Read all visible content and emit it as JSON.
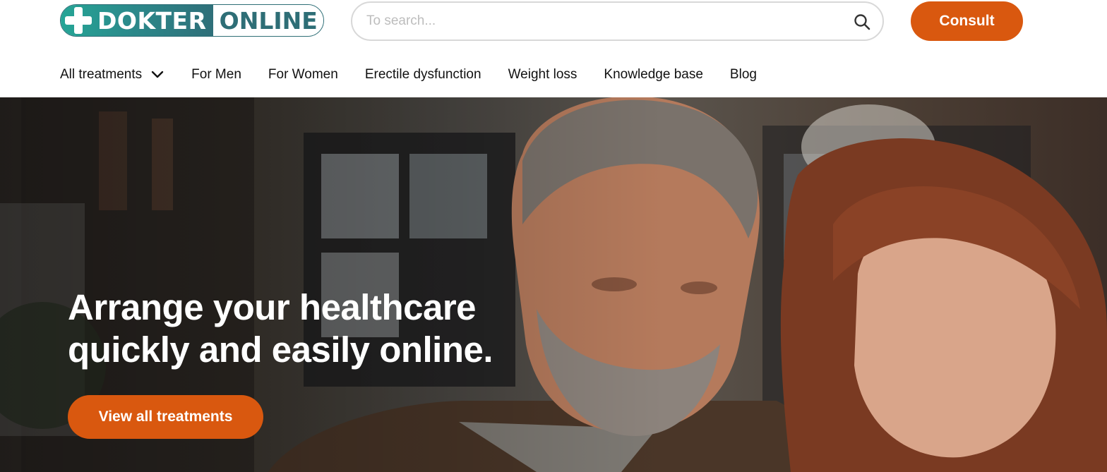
{
  "header": {
    "logo": {
      "word1": "DOKTER",
      "word2": "ONLINE",
      "icon": "plus-icon"
    },
    "search": {
      "placeholder": "To search...",
      "value": "",
      "icon": "search-icon"
    },
    "consult_label": "Consult"
  },
  "nav": {
    "items": [
      {
        "label": "All treatments",
        "has_dropdown": true,
        "icon": "chevron-down-icon"
      },
      {
        "label": "For Men"
      },
      {
        "label": "For Women"
      },
      {
        "label": "Erectile dysfunction"
      },
      {
        "label": "Weight loss"
      },
      {
        "label": "Knowledge base"
      },
      {
        "label": "Blog"
      }
    ]
  },
  "hero": {
    "title_line1": "Arrange your healthcare",
    "title_line2": "quickly and easily online.",
    "cta_label": "View all treatments"
  },
  "colors": {
    "accent": "#d9580f",
    "brand_teal": "#2e6e76",
    "brand_green": "#25a596"
  }
}
